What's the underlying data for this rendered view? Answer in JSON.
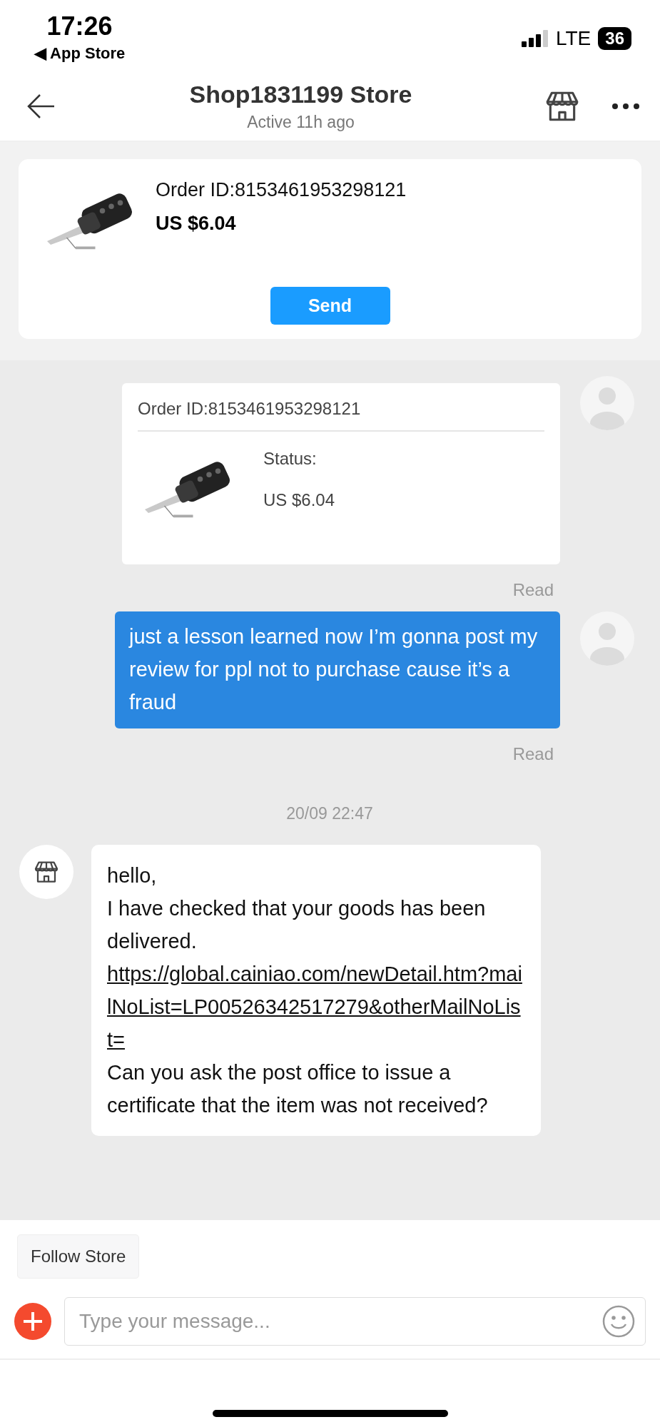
{
  "status_bar": {
    "time": "17:26",
    "back_label": "◀ App Store",
    "network": "LTE",
    "battery": "36"
  },
  "header": {
    "title": "Shop1831199 Store",
    "subtitle": "Active 11h ago"
  },
  "order_card": {
    "order_id": "Order ID:8153461953298121",
    "price": "US $6.04",
    "button": "Send"
  },
  "messages": [
    {
      "kind": "order",
      "order_id": "Order ID:8153461953298121",
      "status": "Status:",
      "price": "US $6.04",
      "receipt": "Read"
    },
    {
      "kind": "text",
      "text": "just a lesson learned now I’m gonna post my review for ppl not to purchase cause it’s a fraud",
      "receipt": "Read"
    },
    {
      "kind": "date",
      "text": "20/09 22:47"
    },
    {
      "kind": "link_text",
      "text_before": "hello,\nI have checked that your goods has been delivered.",
      "link": "https://global.cainiao.com/newDetail.htm?mailNoList=LP00526342517279&otherMailNoList=",
      "text_after": "Can you ask the post office to issue a certificate that the item was not received?"
    }
  ],
  "follow_button": "Follow Store",
  "composer": {
    "placeholder": "Type your message..."
  }
}
